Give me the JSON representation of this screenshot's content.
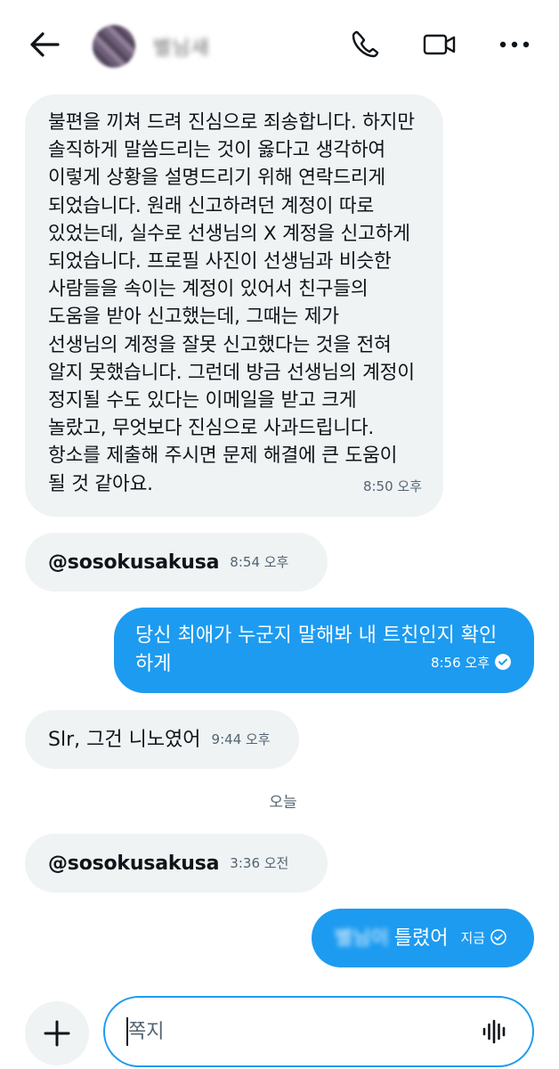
{
  "header": {
    "contact_name": "별님새",
    "icons": [
      "back-arrow-icon",
      "phone-icon",
      "video-icon",
      "more-icon"
    ]
  },
  "messages": [
    {
      "direction": "incoming",
      "text": "불편을 끼쳐 드려 진심으로 죄송합니다. 하지만\n솔직하게 말씀드리는 것이 옳다고 생각하여\n이렇게 상황을 설명드리기 위해 연락드리게\n되었습니다. 원래 신고하려던 계정이 따로\n있었는데, 실수로 선생님의 X 계정을 신고하게\n되었습니다. 프로필 사진이 선생님과 비슷한\n사람들을 속이는 계정이 있어서 친구들의\n도움을 받아 신고했는데, 그때는 제가\n선생님의 계정을 잘못 신고했다는 것을 전혀\n알지 못했습니다. 그런데 방금 선생님의 계정이\n정지될 수도 있다는 이메일을 받고 크게\n놀랐고, 무엇보다 진심으로 사과드립니다.\n항소를 제출해 주시면 문제 해결에 큰 도움이\n될 것 같아요.",
      "time": "8:50 오후"
    },
    {
      "direction": "incoming",
      "text": "@sosokusakusa",
      "time": "8:54 오후"
    },
    {
      "direction": "outgoing",
      "text": "당신 최애가 누군지 말해봐 내 트친인지 확인하게",
      "time": "8:56 오후"
    },
    {
      "direction": "incoming",
      "text": "Slr, 그건 니노였어",
      "time": "9:44 오후"
    },
    {
      "direction": "incoming",
      "text": "@sosokusakusa",
      "time": "3:36 오전"
    },
    {
      "direction": "outgoing",
      "blurred_prefix": "별님이",
      "text": "틀렸어",
      "time": "지금"
    }
  ],
  "day_divider": "오늘",
  "composer": {
    "placeholder": "쪽지"
  },
  "colors": {
    "accent": "#1d9bf0",
    "incoming_bubble": "#eff3f4",
    "text": "#0f1419",
    "muted": "#536471"
  }
}
